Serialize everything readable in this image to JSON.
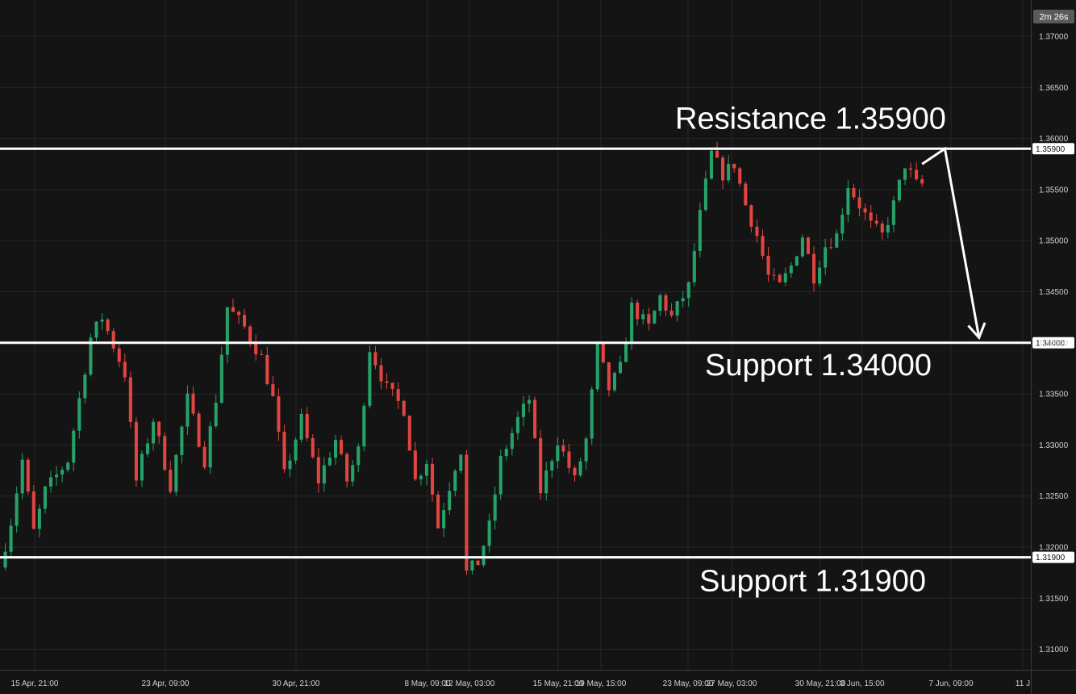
{
  "chart_data": {
    "type": "candlestick",
    "timer": "2m 26s",
    "y_ticks": [
      "1.37000",
      "1.36500",
      "1.36000",
      "1.35500",
      "1.35000",
      "1.34500",
      "1.34000",
      "1.33500",
      "1.33000",
      "1.32500",
      "1.32000",
      "1.31500",
      "1.31000"
    ],
    "x_ticks": [
      "15 Apr, 21:00",
      "23 Apr, 09:00",
      "30 Apr, 21:00",
      "8 May, 09:00",
      "12 May, 03:00",
      "15 May, 21:00",
      "19 May, 15:00",
      "23 May, 09:00",
      "27 May, 03:00",
      "30 May, 21:00",
      "3 Jun, 15:00",
      "7 Jun, 09:00",
      "11 J"
    ],
    "ylim": [
      1.3075,
      1.3735
    ],
    "levels": [
      {
        "name": "Resistance",
        "value": 1.359,
        "label": "Resistance 1.35900",
        "tag": "1.35900"
      },
      {
        "name": "Support",
        "value": 1.34,
        "label": "Support 1.34000",
        "tag": "1.34000"
      },
      {
        "name": "Support",
        "value": 1.319,
        "label": "Support 1.31900",
        "tag": "1.31900"
      }
    ],
    "price_path": [
      [
        0,
        1.318
      ],
      [
        2,
        1.3225
      ],
      [
        4,
        1.3285
      ],
      [
        6,
        1.3215
      ],
      [
        8,
        1.3255
      ],
      [
        12,
        1.3285
      ],
      [
        16,
        1.3405
      ],
      [
        18,
        1.3425
      ],
      [
        22,
        1.337
      ],
      [
        24,
        1.3265
      ],
      [
        27,
        1.3325
      ],
      [
        30,
        1.326
      ],
      [
        33,
        1.3345
      ],
      [
        36,
        1.3285
      ],
      [
        38,
        1.3345
      ],
      [
        40,
        1.3435
      ],
      [
        43,
        1.3415
      ],
      [
        46,
        1.3385
      ],
      [
        48,
        1.3345
      ],
      [
        50,
        1.327
      ],
      [
        53,
        1.3325
      ],
      [
        56,
        1.3265
      ],
      [
        59,
        1.3305
      ],
      [
        61,
        1.3265
      ],
      [
        63,
        1.3295
      ],
      [
        65,
        1.3395
      ],
      [
        68,
        1.3355
      ],
      [
        71,
        1.3335
      ],
      [
        73,
        1.3265
      ],
      [
        75,
        1.3285
      ],
      [
        77,
        1.322
      ],
      [
        80,
        1.328
      ],
      [
        81,
        1.3295
      ],
      [
        82,
        1.3175
      ],
      [
        84,
        1.3185
      ],
      [
        86,
        1.322
      ],
      [
        88,
        1.3285
      ],
      [
        91,
        1.3325
      ],
      [
        93,
        1.3345
      ],
      [
        95,
        1.3255
      ],
      [
        98,
        1.3305
      ],
      [
        101,
        1.3265
      ],
      [
        103,
        1.3305
      ],
      [
        105,
        1.3395
      ],
      [
        107,
        1.3355
      ],
      [
        109,
        1.3375
      ],
      [
        111,
        1.3435
      ],
      [
        114,
        1.3415
      ],
      [
        116,
        1.3445
      ],
      [
        118,
        1.3425
      ],
      [
        121,
        1.3455
      ],
      [
        123,
        1.3525
      ],
      [
        125,
        1.3585
      ],
      [
        127,
        1.3565
      ],
      [
        129,
        1.3575
      ],
      [
        131,
        1.3535
      ],
      [
        133,
        1.3505
      ],
      [
        135,
        1.3465
      ],
      [
        137,
        1.3455
      ],
      [
        139,
        1.3475
      ],
      [
        141,
        1.3505
      ],
      [
        143,
        1.3465
      ],
      [
        145,
        1.3495
      ],
      [
        147,
        1.3505
      ],
      [
        149,
        1.3555
      ],
      [
        151,
        1.3535
      ],
      [
        153,
        1.3515
      ],
      [
        155,
        1.3505
      ],
      [
        157,
        1.3535
      ],
      [
        159,
        1.3575
      ],
      [
        161,
        1.3555
      ]
    ],
    "forecast_arrow": {
      "points": [
        [
          161,
          1.3575
        ],
        [
          165,
          1.359
        ],
        [
          171,
          1.3405
        ]
      ],
      "direction": "down"
    }
  }
}
